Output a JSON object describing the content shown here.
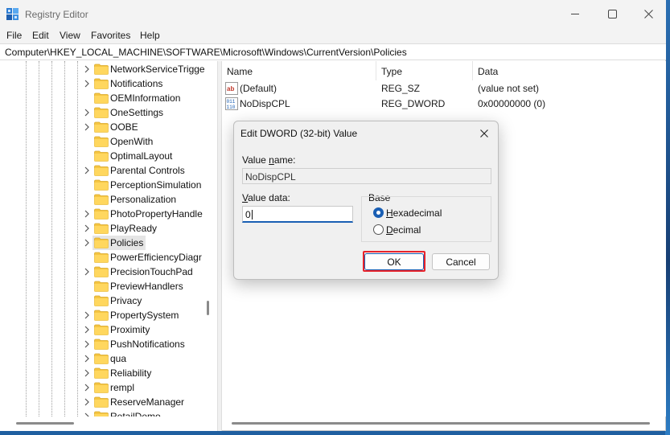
{
  "window": {
    "title": "Registry Editor",
    "icon": "registry-editor-icon",
    "controls": {
      "minimize": "minimize-icon",
      "maximize": "maximize-icon",
      "close": "close-icon"
    }
  },
  "menu": {
    "items": [
      "File",
      "Edit",
      "View",
      "Favorites",
      "Help"
    ]
  },
  "address": {
    "path": "Computer\\HKEY_LOCAL_MACHINE\\SOFTWARE\\Microsoft\\Windows\\CurrentVersion\\Policies"
  },
  "tree": {
    "items": [
      {
        "label": "NetworkServiceTrigge",
        "expandable": true
      },
      {
        "label": "Notifications",
        "expandable": true
      },
      {
        "label": "OEMInformation",
        "expandable": false
      },
      {
        "label": "OneSettings",
        "expandable": true
      },
      {
        "label": "OOBE",
        "expandable": true
      },
      {
        "label": "OpenWith",
        "expandable": false
      },
      {
        "label": "OptimalLayout",
        "expandable": false
      },
      {
        "label": "Parental Controls",
        "expandable": true
      },
      {
        "label": "PerceptionSimulation",
        "expandable": false
      },
      {
        "label": "Personalization",
        "expandable": false
      },
      {
        "label": "PhotoPropertyHandle",
        "expandable": true
      },
      {
        "label": "PlayReady",
        "expandable": true
      },
      {
        "label": "Policies",
        "expandable": true,
        "selected": true
      },
      {
        "label": "PowerEfficiencyDiagr",
        "expandable": false
      },
      {
        "label": "PrecisionTouchPad",
        "expandable": true
      },
      {
        "label": "PreviewHandlers",
        "expandable": false
      },
      {
        "label": "Privacy",
        "expandable": false
      },
      {
        "label": "PropertySystem",
        "expandable": true
      },
      {
        "label": "Proximity",
        "expandable": true
      },
      {
        "label": "PushNotifications",
        "expandable": true
      },
      {
        "label": "qua",
        "expandable": true
      },
      {
        "label": "Reliability",
        "expandable": true
      },
      {
        "label": "rempl",
        "expandable": true
      },
      {
        "label": "ReserveManager",
        "expandable": true
      },
      {
        "label": "RetailDemo",
        "expandable": true
      }
    ]
  },
  "list": {
    "columns": [
      "Name",
      "Type",
      "Data"
    ],
    "rows": [
      {
        "name": "(Default)",
        "type": "REG_SZ",
        "data": "(value not set)",
        "icon": "string-value-icon"
      },
      {
        "name": "NoDispCPL",
        "type": "REG_DWORD",
        "data": "0x00000000 (0)",
        "icon": "dword-value-icon"
      }
    ]
  },
  "dialog": {
    "title": "Edit DWORD (32-bit) Value",
    "value_name_label_pre": "Value ",
    "value_name_label_ul": "n",
    "value_name_label_post": "ame:",
    "value_name": "NoDispCPL",
    "value_data_label_pre": "",
    "value_data_label_ul": "V",
    "value_data_label_post": "alue data:",
    "value_data": "0",
    "base_label": "Base",
    "radio_hex_ul": "H",
    "radio_hex_rest": "exadecimal",
    "radio_dec_ul": "D",
    "radio_dec_rest": "ecimal",
    "selected_base": "Hexadecimal",
    "ok_label": "OK",
    "cancel_label": "Cancel"
  },
  "colors": {
    "accent": "#1a5fb4",
    "highlight": "#e8232b",
    "folder": "#f5c542"
  }
}
